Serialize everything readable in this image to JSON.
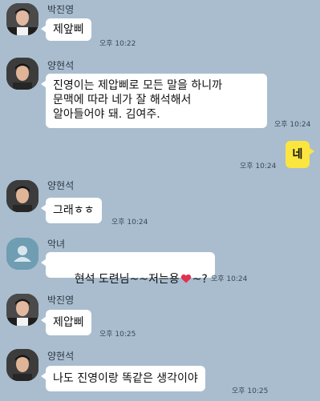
{
  "colors": {
    "background": "#a9bdcf",
    "bubble_other": "#ffffff",
    "bubble_mine": "#fbe53f",
    "heart": "#e0334f"
  },
  "messages": [
    {
      "sender": "박진영",
      "text": "제앞삐",
      "time": "오후 10:22",
      "avatar": "person-photo"
    },
    {
      "sender": "양현석",
      "text": "진영이는 제압삐로 모든 말을 하니까\n문맥에 따라 네가 잘 해석해서\n알아들어야 돼. 김여주.",
      "time": "오후 10:24",
      "avatar": "person-photo"
    },
    {
      "sender": "me",
      "text": "네",
      "time": "오후 10:24"
    },
    {
      "sender": "양현석",
      "text": "그래ㅎㅎ",
      "time": "오후 10:24",
      "avatar": "person-photo"
    },
    {
      "sender": "악녀",
      "text_before": "현석 도련님~~저는용",
      "text_after": "~?",
      "emoji": "heart-emoji",
      "time": "오후 10:24",
      "avatar": "default-profile-icon"
    },
    {
      "sender": "박진영",
      "text": "제압삐",
      "time": "오후 10:25",
      "avatar": "person-photo"
    },
    {
      "sender": "양현석",
      "text": "나도 진영이랑 똑같은 생각이야",
      "time": "오후 10:25",
      "avatar": "person-photo"
    }
  ]
}
